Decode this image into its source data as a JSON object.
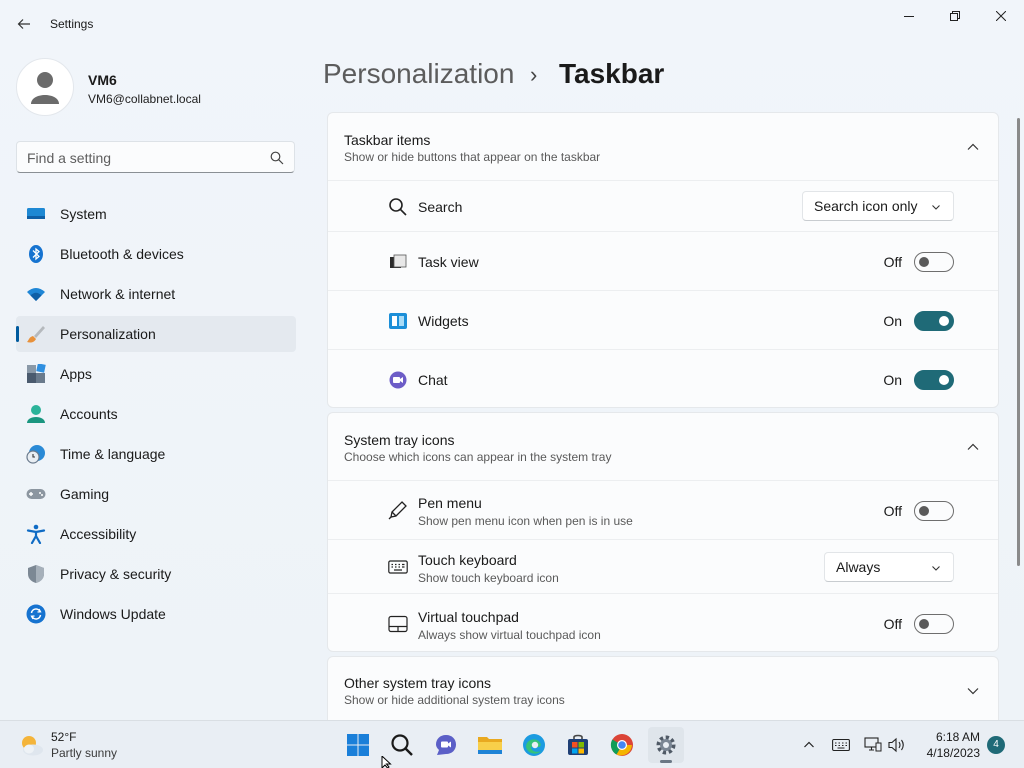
{
  "window": {
    "title": "Settings"
  },
  "user": {
    "name": "VM6",
    "email": "VM6@collabnet.local"
  },
  "search": {
    "placeholder": "Find a setting"
  },
  "sidebar": {
    "items": [
      {
        "label": "System",
        "icon": "system-icon"
      },
      {
        "label": "Bluetooth & devices",
        "icon": "bluetooth-icon"
      },
      {
        "label": "Network & internet",
        "icon": "wifi-icon"
      },
      {
        "label": "Personalization",
        "icon": "brush-icon",
        "selected": true
      },
      {
        "label": "Apps",
        "icon": "apps-icon"
      },
      {
        "label": "Accounts",
        "icon": "accounts-icon"
      },
      {
        "label": "Time & language",
        "icon": "globe-clock-icon"
      },
      {
        "label": "Gaming",
        "icon": "gamepad-icon"
      },
      {
        "label": "Accessibility",
        "icon": "accessibility-icon"
      },
      {
        "label": "Privacy & security",
        "icon": "shield-icon"
      },
      {
        "label": "Windows Update",
        "icon": "update-icon"
      }
    ]
  },
  "header": {
    "parent": "Personalization",
    "separator": "›",
    "current": "Taskbar"
  },
  "taskbar_items": {
    "title": "Taskbar items",
    "subtitle": "Show or hide buttons that appear on the taskbar",
    "rows": [
      {
        "label": "Search",
        "icon": "search-icon",
        "control": "dropdown",
        "value": "Search icon only"
      },
      {
        "label": "Task view",
        "icon": "task-view-icon",
        "control": "toggle",
        "state": "Off",
        "on": false
      },
      {
        "label": "Widgets",
        "icon": "widgets-icon",
        "control": "toggle",
        "state": "On",
        "on": true
      },
      {
        "label": "Chat",
        "icon": "chat-icon",
        "control": "toggle",
        "state": "On",
        "on": true
      }
    ]
  },
  "system_tray": {
    "title": "System tray icons",
    "subtitle": "Choose which icons can appear in the system tray",
    "rows": [
      {
        "label": "Pen menu",
        "sub": "Show pen menu icon when pen is in use",
        "icon": "pen-icon",
        "control": "toggle",
        "state": "Off",
        "on": false
      },
      {
        "label": "Touch keyboard",
        "sub": "Show touch keyboard icon",
        "icon": "keyboard-icon",
        "control": "dropdown",
        "value": "Always"
      },
      {
        "label": "Virtual touchpad",
        "sub": "Always show virtual touchpad icon",
        "icon": "touchpad-icon",
        "control": "toggle",
        "state": "Off",
        "on": false
      }
    ]
  },
  "other_tray": {
    "title": "Other system tray icons",
    "subtitle": "Show or hide additional system tray icons"
  },
  "taskbar": {
    "weather": {
      "temp": "52°F",
      "desc": "Partly sunny"
    },
    "apps": [
      "start-icon",
      "search-icon",
      "teams-chat-icon",
      "file-explorer-icon",
      "edge-icon",
      "store-icon",
      "chrome-icon",
      "settings-icon"
    ],
    "clock": {
      "time": "6:18 AM",
      "date": "4/18/2023"
    },
    "notifications": "4"
  },
  "colors": {
    "accent": "#1f6a77",
    "nav_indicator": "#005a9e"
  }
}
